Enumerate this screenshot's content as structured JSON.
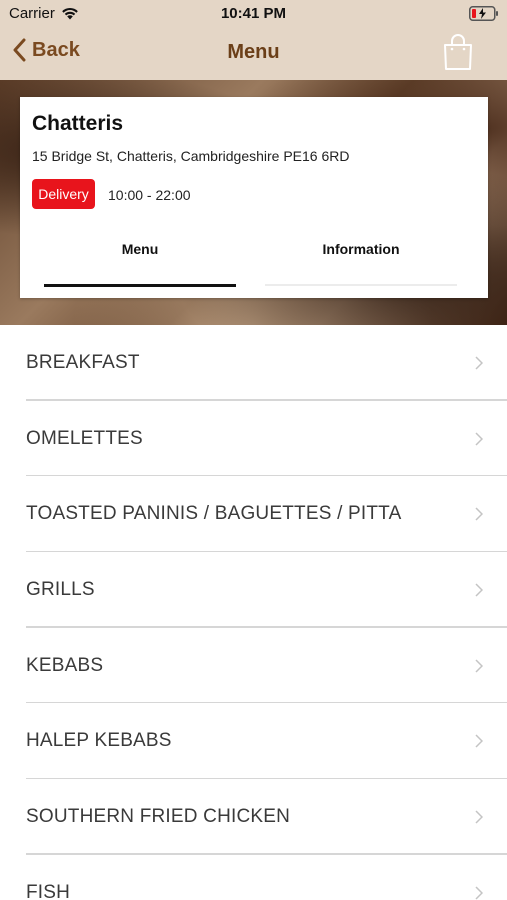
{
  "status_bar": {
    "carrier": "Carrier",
    "time": "10:41 PM"
  },
  "nav": {
    "back_label": "Back",
    "title": "Menu",
    "icons": {
      "back": "chevron-left-icon",
      "cart": "shopping-bag-icon"
    }
  },
  "restaurant": {
    "name": "Chatteris",
    "address": "15 Bridge St, Chatteris, Cambridgeshire PE16 6RD",
    "delivery_badge": "Delivery",
    "hours": "10:00 - 22:00"
  },
  "tabs": [
    {
      "label": "Menu",
      "active": true
    },
    {
      "label": "Information",
      "active": false
    }
  ],
  "menu_categories": [
    "BREAKFAST",
    "OMELETTES",
    "TOASTED PANINIS / BAGUETTES / PITTA",
    "GRILLS",
    "KEBABS",
    "HALEP KEBABS",
    "SOUTHERN FRIED CHICKEN",
    "FISH"
  ],
  "colors": {
    "nav_background": "#e4d6c6",
    "nav_text": "#6b3f18",
    "badge_red": "#e8141c",
    "battery_low": "#e8141c"
  }
}
